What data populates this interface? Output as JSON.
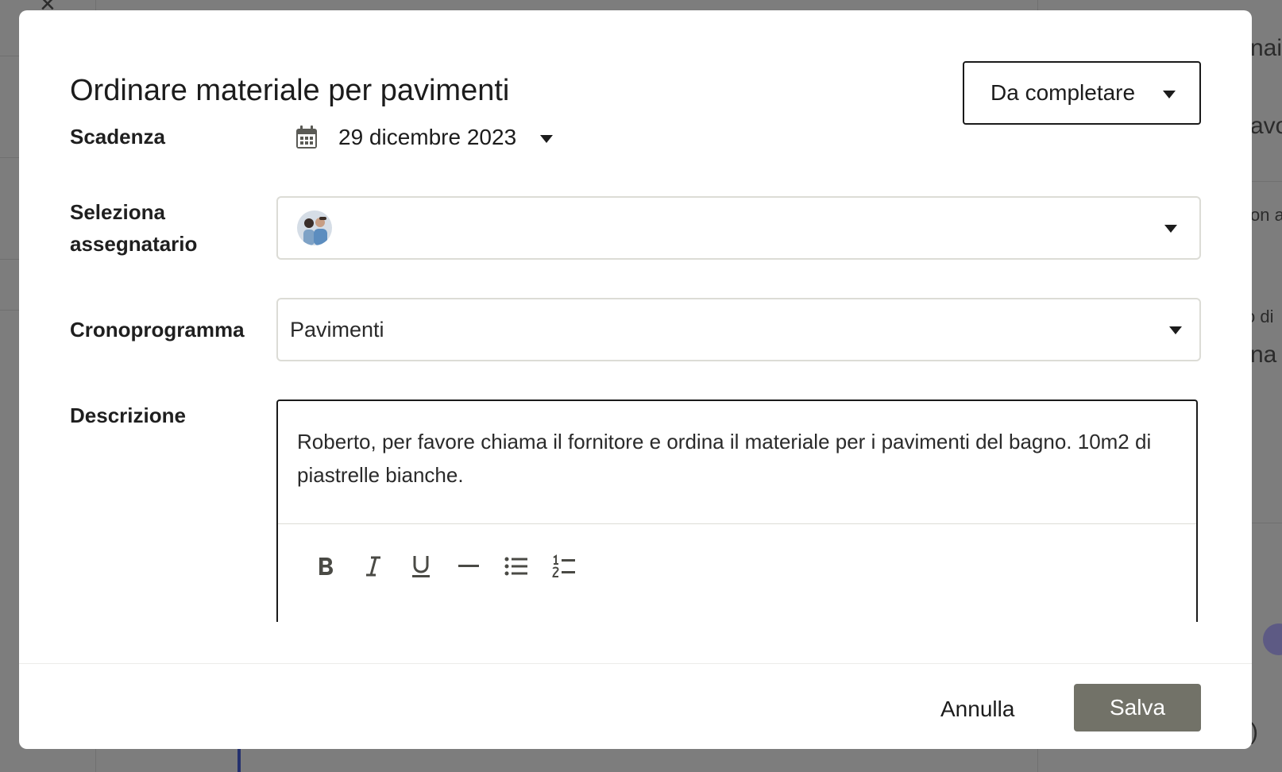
{
  "background": {
    "fragments": [
      "naio",
      "avo",
      "on a",
      "o di",
      "na",
      ")"
    ]
  },
  "dialog": {
    "title": "Ordinare materiale per pavimenti",
    "status": {
      "value": "Da completare"
    },
    "deadline": {
      "label": "Scadenza",
      "value": "29 dicembre 2023",
      "icon": "calendar-icon"
    },
    "assignee": {
      "label": "Seleziona assegnatario",
      "avatar": "avatar"
    },
    "schedule": {
      "label": "Cronoprogramma",
      "value": "Pavimenti"
    },
    "description": {
      "label": "Descrizione",
      "text": "Roberto, per favore chiama il fornitore e ordina il materiale per i pavimenti del bagno. 10m2 di piastrelle bianche.",
      "toolbar": [
        "bold-icon",
        "italic-icon",
        "underline-icon",
        "horizontal-rule-icon",
        "bullet-list-icon",
        "numbered-list-icon"
      ]
    },
    "actions": {
      "cancel": "Annulla",
      "save": "Salva"
    }
  },
  "colors": {
    "overlay": "#7d7d7d",
    "save_button": "#727268",
    "border": "#dcdcd6"
  }
}
